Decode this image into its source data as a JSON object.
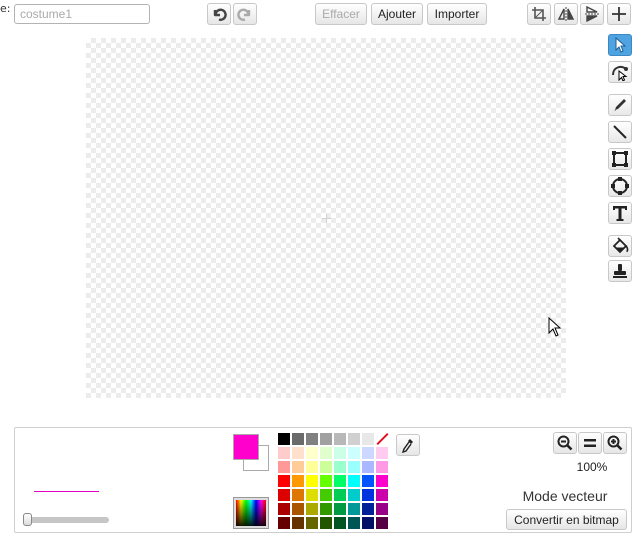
{
  "header": {
    "name_prefix": "e:",
    "costume_name_placeholder": "costume1",
    "clear_label": "Effacer",
    "add_label": "Ajouter",
    "import_label": "Importer"
  },
  "tools": [
    {
      "id": "select",
      "icon": "arrow-select-icon",
      "selected": true
    },
    {
      "id": "reshape",
      "icon": "reshape-icon",
      "selected": false
    },
    {
      "id": "pencil",
      "icon": "pencil-icon",
      "selected": false
    },
    {
      "id": "line",
      "icon": "line-icon",
      "selected": false
    },
    {
      "id": "rectangle",
      "icon": "rectangle-icon",
      "selected": false
    },
    {
      "id": "ellipse",
      "icon": "ellipse-icon",
      "selected": false
    },
    {
      "id": "text",
      "icon": "text-icon",
      "selected": false
    },
    {
      "id": "fill",
      "icon": "paint-bucket-icon",
      "selected": false
    },
    {
      "id": "stamp",
      "icon": "stamp-icon",
      "selected": false
    }
  ],
  "colors": {
    "foreground": "#ff00cc",
    "background": "#ffffff",
    "stroke": "#e000c8",
    "selected_tool": "#4fa3e0",
    "palette": [
      "#000000",
      "#6a6a6a",
      "#808080",
      "#a0a0a0",
      "#b8b8b8",
      "#d0d0d0",
      "#e8e8e8",
      "none",
      "#ffcccc",
      "#ffe0cc",
      "#ffffcc",
      "#e0ffcc",
      "#ccffe8",
      "#ccffff",
      "#ccd8ff",
      "#ffccf0",
      "#ff9999",
      "#ffcc99",
      "#ffff99",
      "#ccff99",
      "#99ffcc",
      "#99ffff",
      "#aab8ff",
      "#ff99e6",
      "#ff0000",
      "#ff9900",
      "#ffff00",
      "#66ff00",
      "#00ff66",
      "#00ffff",
      "#0055ff",
      "#ff00cc",
      "#dd0000",
      "#dd7700",
      "#dddd00",
      "#44cc00",
      "#00cc55",
      "#00cccc",
      "#0033dd",
      "#cc00aa",
      "#aa0000",
      "#aa5500",
      "#aaaa00",
      "#339900",
      "#009944",
      "#009999",
      "#002299",
      "#990088",
      "#660000",
      "#663300",
      "#666600",
      "#225500",
      "#005522",
      "#005555",
      "#001166",
      "#550044"
    ]
  },
  "zoom": {
    "level": "100%"
  },
  "mode": {
    "label": "Mode vecteur",
    "convert_label": "Convertir en bitmap"
  }
}
